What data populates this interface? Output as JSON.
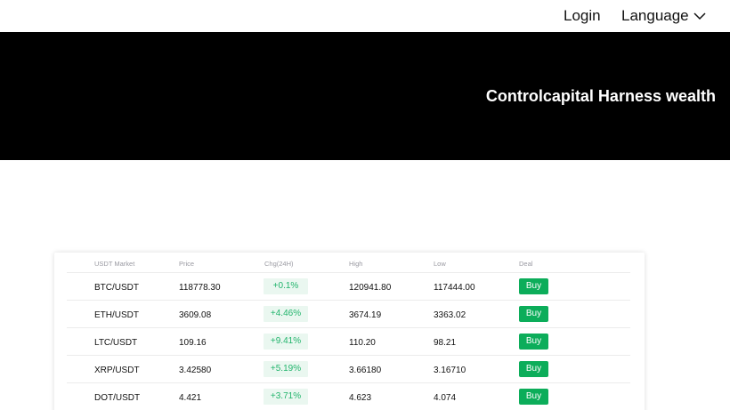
{
  "nav": {
    "login_label": "Login",
    "language_label": "Language"
  },
  "hero": {
    "title": "Controlcapital Harness wealth"
  },
  "market": {
    "headers": [
      "USDT Market",
      "Price",
      "Chg(24H)",
      "High",
      "Low",
      "Deal"
    ],
    "rows": [
      {
        "pair": "BTC/USDT",
        "price": "118778.30",
        "chg": "+0.1%",
        "high": "120941.80",
        "low": "117444.00",
        "deal": "Buy"
      },
      {
        "pair": "ETH/USDT",
        "price": "3609.08",
        "chg": "+4.46%",
        "high": "3674.19",
        "low": "3363.02",
        "deal": "Buy"
      },
      {
        "pair": "LTC/USDT",
        "price": "109.16",
        "chg": "+9.41%",
        "high": "110.20",
        "low": "98.21",
        "deal": "Buy"
      },
      {
        "pair": "XRP/USDT",
        "price": "3.42580",
        "chg": "+5.19%",
        "high": "3.66180",
        "low": "3.16710",
        "deal": "Buy"
      },
      {
        "pair": "DOT/USDT",
        "price": "4.421",
        "chg": "+3.71%",
        "high": "4.623",
        "low": "4.074",
        "deal": "Buy"
      }
    ]
  },
  "colors": {
    "hero_background": "#000000",
    "change_positive_text": "#22b46c",
    "change_positive_background": "#eaf7f0",
    "buy_button": "#0cad5a"
  },
  "icons": {
    "language_dropdown": "chevron-down-icon"
  }
}
